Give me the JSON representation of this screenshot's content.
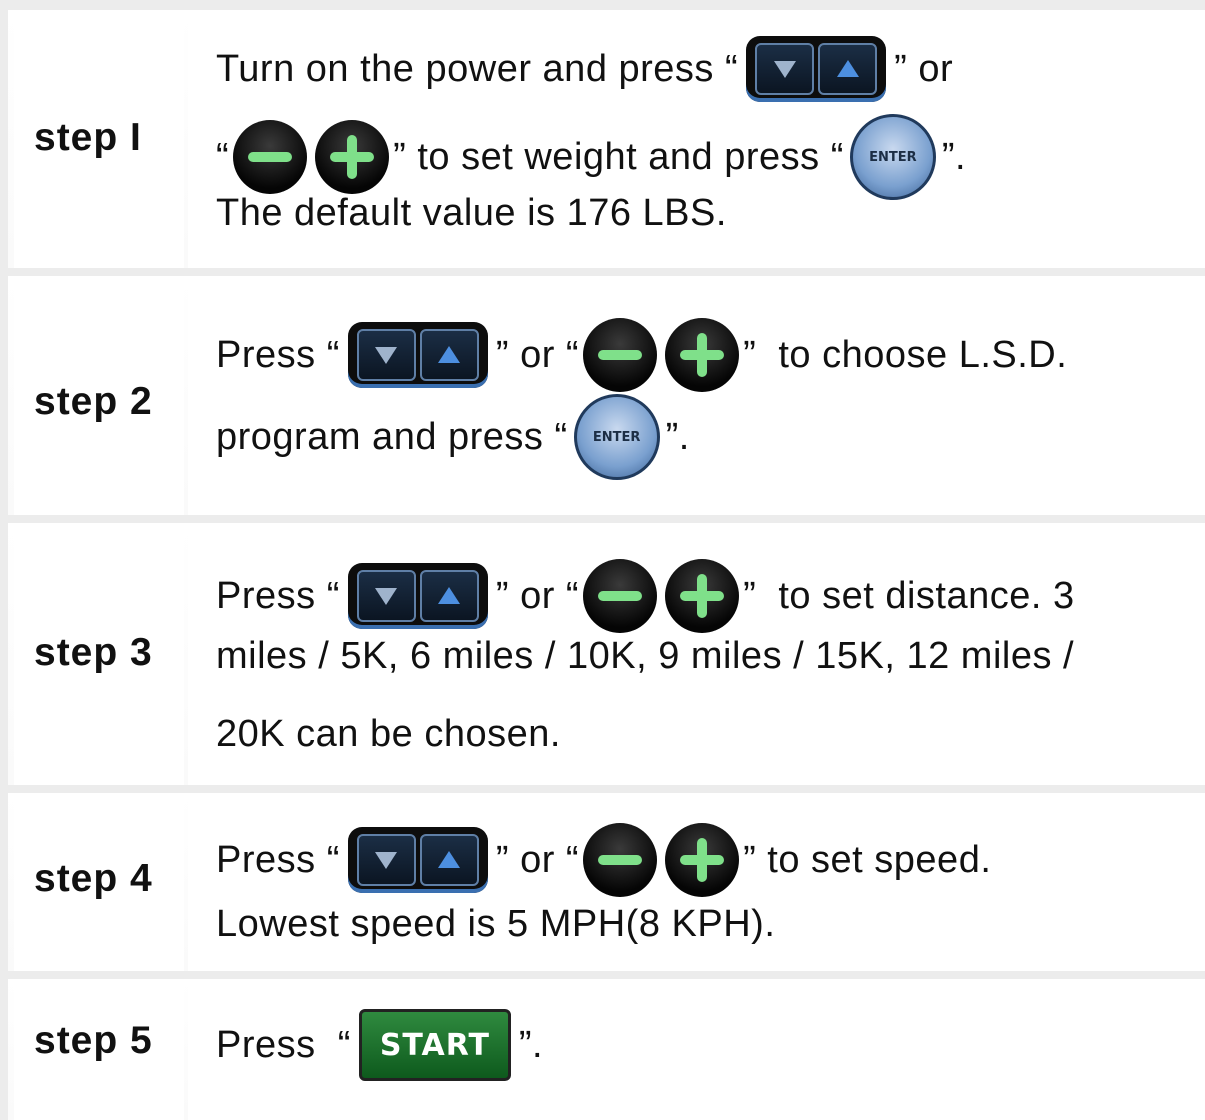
{
  "steps": [
    {
      "label": "step I",
      "lines": [
        {
          "parts": [
            "Turn on the power and press “",
            "arrow-pair",
            "” or"
          ]
        },
        {
          "parts": [
            "“",
            "minus",
            "plus",
            "” to set weight and press “",
            "enter",
            "”."
          ]
        },
        {
          "parts": [
            "The default value is 176 LBS."
          ]
        }
      ]
    },
    {
      "label": "step 2",
      "lines": [
        {
          "parts": [
            "Press “",
            "arrow-pair",
            "” or “",
            "minus",
            "plus",
            "”  to choose L.S.D."
          ]
        },
        {
          "parts": [
            "program and press “",
            "enter",
            "”."
          ]
        }
      ]
    },
    {
      "label": "step 3",
      "lines": [
        {
          "parts": [
            "Press “",
            "arrow-pair",
            "” or “",
            "minus",
            "plus",
            "”  to set distance. 3"
          ]
        },
        {
          "parts": [
            "miles / 5K, 6 miles / 10K, 9 miles / 15K, 12 miles /"
          ]
        },
        {
          "parts": [
            "20K can be chosen."
          ]
        }
      ]
    },
    {
      "label": "step 4",
      "lines": [
        {
          "parts": [
            "Press “",
            "arrow-pair",
            "” or “",
            "minus",
            "plus",
            "” to set speed."
          ]
        },
        {
          "parts": [
            "Lowest speed is 5 MPH(8 KPH)."
          ]
        }
      ]
    },
    {
      "label": "step 5",
      "lines": [
        {
          "parts": [
            "Press  “",
            "start",
            "”."
          ]
        }
      ]
    }
  ],
  "buttons": {
    "enter_label": "ENTER",
    "start_label": "START"
  },
  "colors": {
    "arrow_blue": "#3a6fb0",
    "plus_minus_green": "#7fe08a",
    "start_green": "#1f7a30"
  }
}
